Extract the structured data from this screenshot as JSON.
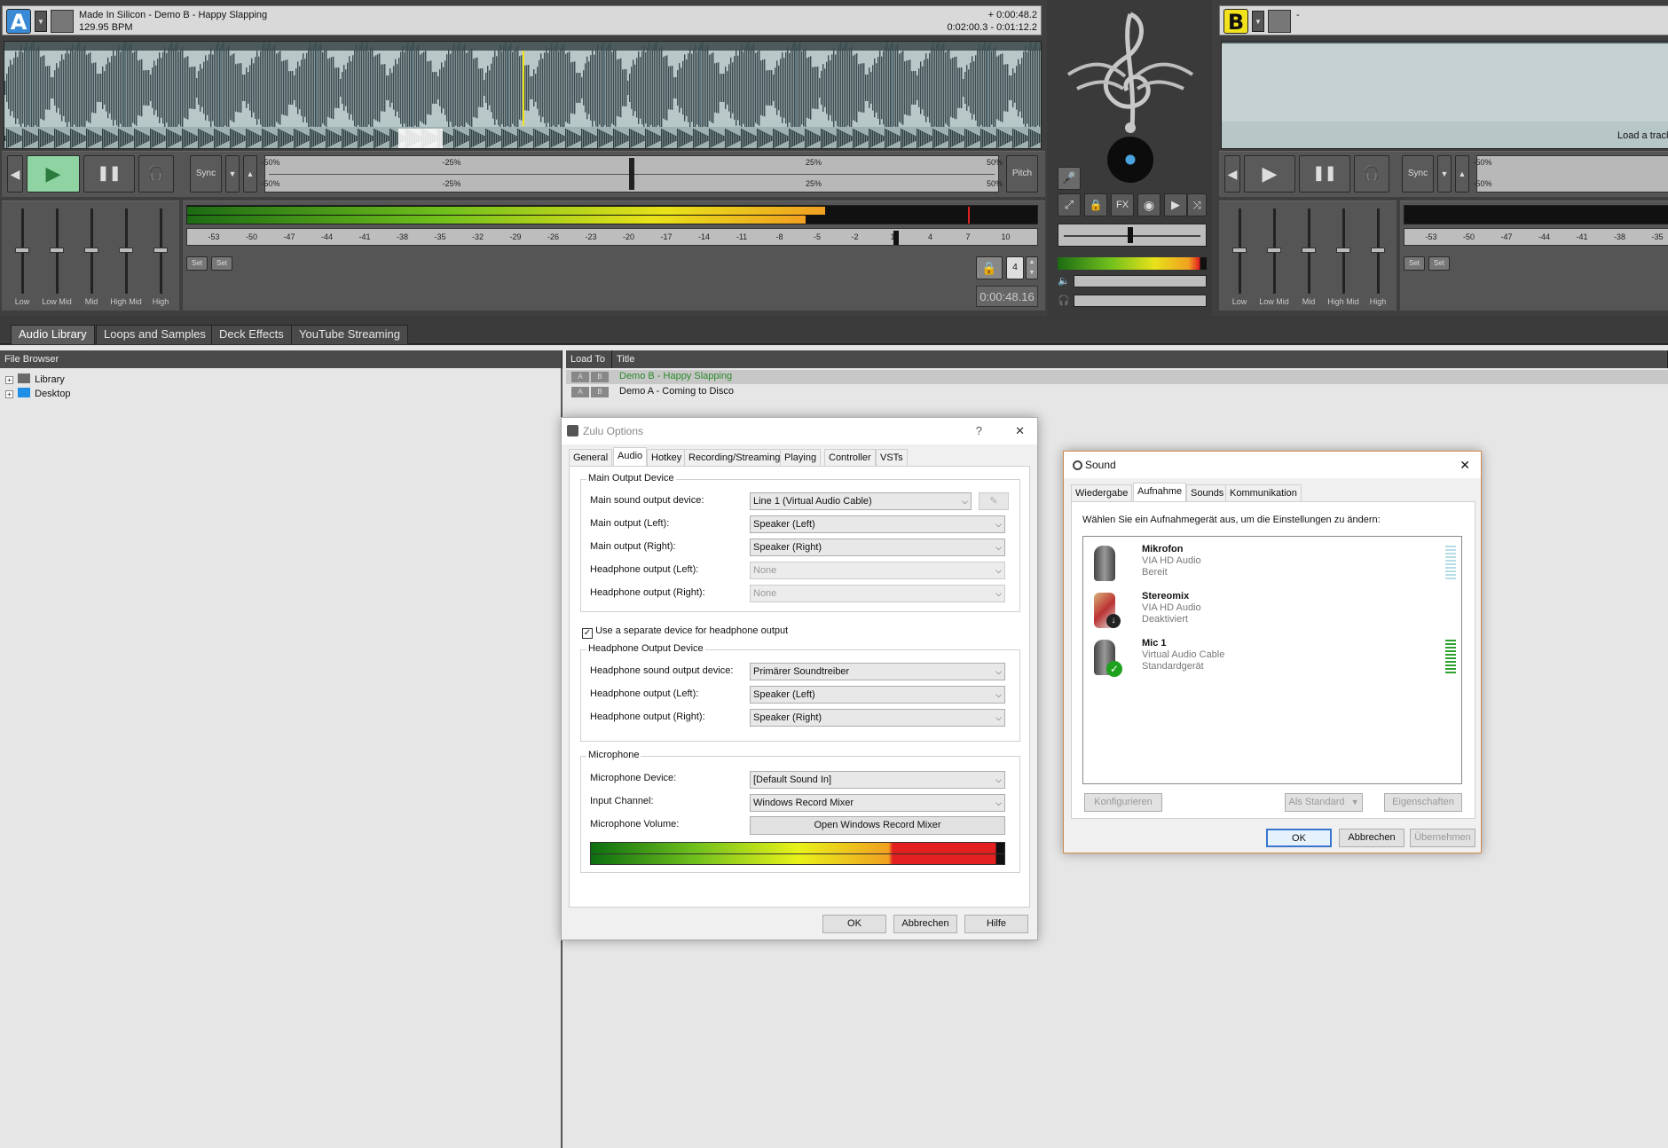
{
  "deck_a": {
    "letter": "A",
    "track_title": "Made In Silicon - Demo B - Happy Slapping",
    "bpm": "129.95 BPM",
    "elapsed": "+ 0:00:48.2",
    "remaining": "0:02:00.3 - 0:01:12.2",
    "sync_label": "Sync",
    "pitch_label": "Pitch",
    "pitch_scale": [
      "-50%",
      "-25%",
      "0",
      "25%",
      "50%"
    ],
    "pitch_scale_bottom": [
      "-50%",
      "-25%",
      "0",
      "25%",
      "50%"
    ],
    "eq_labels": [
      "Low",
      "Low Mid",
      "Mid",
      "High Mid",
      "High"
    ],
    "db_scale": [
      "-53",
      "-50",
      "-47",
      "-44",
      "-41",
      "-38",
      "-35",
      "-32",
      "-29",
      "-26",
      "-23",
      "-20",
      "-17",
      "-14",
      "-11",
      "-8",
      "-5",
      "-2",
      "1",
      "4",
      "7",
      "10"
    ],
    "set_labels": [
      "Set",
      "Set"
    ],
    "loop_count": "4",
    "time_readout": "0:00:48.16",
    "level_fraction": 0.75,
    "accent_color": "#3a8ad6"
  },
  "deck_b": {
    "letter": "B",
    "track_title": "-",
    "load_hint": "Load a track i",
    "sync_label": "Sync",
    "pitch_scale": [
      "-50%",
      "-25"
    ],
    "pitch_scale_bottom": [
      "-50%",
      "-25"
    ],
    "eq_labels": [
      "Low",
      "Low Mid",
      "Mid",
      "High Mid",
      "High"
    ],
    "db_scale": [
      "-53",
      "-50",
      "-47",
      "-44",
      "-41",
      "-38",
      "-35"
    ],
    "set_labels": [
      "Set",
      "Set"
    ],
    "accent_color": "#f2e21b"
  },
  "center": {
    "fx_label": "FX",
    "logo_icon": "treble-clef-logo"
  },
  "tabs": [
    "Audio Library",
    "Loops and Samples",
    "Deck Effects",
    "YouTube Streaming"
  ],
  "active_tab": "Audio Library",
  "file_browser": {
    "header": "File Browser",
    "items": [
      "Library",
      "Desktop"
    ]
  },
  "track_list": {
    "col_load": "Load To",
    "col_title": "Title",
    "rows": [
      {
        "a": "A",
        "b": "B",
        "title": "Demo B - Happy Slapping",
        "highlight": true
      },
      {
        "a": "A",
        "b": "B",
        "title": "Demo A - Coming to Disco",
        "highlight": false
      }
    ]
  },
  "zulu_options": {
    "title": "Zulu Options",
    "help_glyph": "?",
    "close_glyph": "✕",
    "tabs": [
      "General",
      "Audio",
      "Hotkey",
      "Recording/Streaming",
      "Playing",
      "Controller",
      "VSTs"
    ],
    "active_tab": "Audio",
    "main_output": {
      "group": "Main Output Device",
      "rows": [
        {
          "label": "Main sound output device:",
          "value": "Line 1 (Virtual Audio Cable)",
          "disabled": false
        },
        {
          "label": "Main output (Left):",
          "value": "Speaker (Left)",
          "disabled": false
        },
        {
          "label": "Main output (Right):",
          "value": "Speaker (Right)",
          "disabled": false
        },
        {
          "label": "Headphone output (Left):",
          "value": "None",
          "disabled": true
        },
        {
          "label": "Headphone output (Right):",
          "value": "None",
          "disabled": true
        }
      ]
    },
    "separate_headphone_checkbox": "Use a separate device for headphone output",
    "separate_headphone_checked": true,
    "headphone_output": {
      "group": "Headphone Output Device",
      "rows": [
        {
          "label": "Headphone sound output device:",
          "value": "Primärer Soundtreiber"
        },
        {
          "label": "Headphone output (Left):",
          "value": "Speaker (Left)"
        },
        {
          "label": "Headphone output (Right):",
          "value": "Speaker (Right)"
        }
      ]
    },
    "microphone": {
      "group": "Microphone",
      "device_label": "Microphone Device:",
      "device_value": "[Default Sound In]",
      "channel_label": "Input Channel:",
      "channel_value": "Windows Record Mixer",
      "volume_label": "Microphone Volume:",
      "volume_button": "Open Windows Record Mixer"
    },
    "buttons": {
      "ok": "OK",
      "cancel": "Abbrechen",
      "help": "Hilfe"
    }
  },
  "sound_dialog": {
    "title": "Sound",
    "close_glyph": "✕",
    "tabs": [
      "Wiedergabe",
      "Aufnahme",
      "Sounds",
      "Kommunikation"
    ],
    "active_tab": "Aufnahme",
    "instruction": "Wählen Sie ein Aufnahmegerät aus, um die Einstellungen zu ändern:",
    "devices": [
      {
        "name": "Mikrofon",
        "driver": "VIA HD Audio",
        "status": "Bereit",
        "icon": "microphone-icon",
        "level": 0
      },
      {
        "name": "Stereomix",
        "driver": "VIA HD Audio",
        "status": "Deaktiviert",
        "icon": "stereomix-cable-icon",
        "level": null
      },
      {
        "name": "Mic 1",
        "driver": "Virtual Audio Cable",
        "status": "Standardgerät",
        "icon": "microphone-default-icon",
        "level": 1
      }
    ],
    "buttons": {
      "configure": "Konfigurieren",
      "set_default": "Als Standard",
      "properties": "Eigenschaften",
      "ok": "OK",
      "cancel": "Abbrechen",
      "apply": "Übernehmen"
    }
  }
}
